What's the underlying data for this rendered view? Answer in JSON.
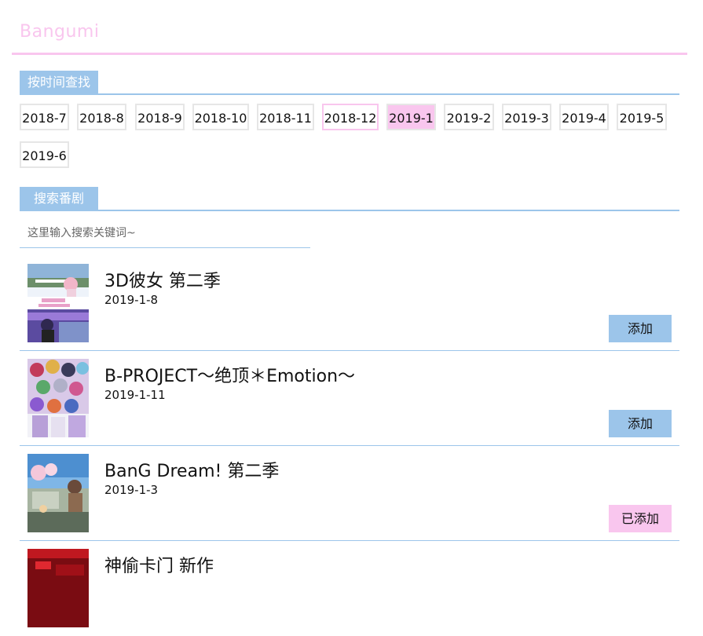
{
  "brand": "Bangumi",
  "colors": {
    "pink": "#f9c6ee",
    "blue": "#9cc5ea"
  },
  "time_section": {
    "label": "按时间查找"
  },
  "months": [
    "2018-7",
    "2018-8",
    "2018-9",
    "2018-10",
    "2018-11",
    "2018-12",
    "2019-1",
    "2019-2",
    "2019-3",
    "2019-4",
    "2019-5",
    "2019-6"
  ],
  "months_state": {
    "selected": "2019-1",
    "outlined": "2018-12"
  },
  "search_section": {
    "label": "搜索番剧"
  },
  "search": {
    "placeholder": "这里输入搜索关键词~",
    "value": ""
  },
  "items": [
    {
      "title": "3D彼女 第二季",
      "date": "2019-1-8",
      "button": "添加",
      "added": false,
      "thumb_icon": "anime-poster-thumbnail"
    },
    {
      "title": "B-PROJECT～绝顶＊Emotion～",
      "date": "2019-1-11",
      "button": "添加",
      "added": false,
      "thumb_icon": "anime-poster-thumbnail"
    },
    {
      "title": "BanG Dream! 第二季",
      "date": "2019-1-3",
      "button": "已添加",
      "added": true,
      "thumb_icon": "anime-poster-thumbnail"
    },
    {
      "title": "神偷卡门 新作",
      "date": "",
      "button": "",
      "added": false,
      "thumb_icon": "anime-poster-thumbnail"
    }
  ]
}
